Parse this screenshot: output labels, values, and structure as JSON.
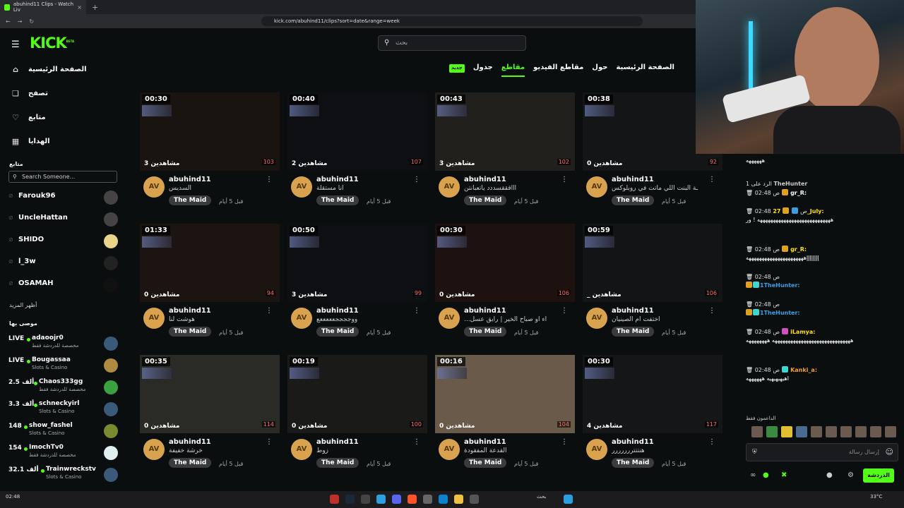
{
  "browser": {
    "tab_title": "abuhind11 Clips - Watch Liv",
    "new_tab": "+",
    "close_tab": "×",
    "url": "kick.com/abuhind11/clips?sort=date&range=week"
  },
  "header": {
    "logo": "KICK",
    "logo_sup": "BETA",
    "search_placeholder": "بحث"
  },
  "sidebar": {
    "nav": [
      {
        "label": "الصفحة الرئيسية"
      },
      {
        "label": "تصفح"
      },
      {
        "label": "متابع"
      },
      {
        "label": "الهدايا"
      }
    ],
    "following_title": "متابع",
    "search_placeholder": "Search Someone...",
    "following": [
      {
        "name": "Farouk96"
      },
      {
        "name": "UncleHattan"
      },
      {
        "name": "SHIDO"
      },
      {
        "name": "l_3w"
      },
      {
        "name": "OSAMAH"
      }
    ],
    "show_more": "أظهر المزيد",
    "recommended_title": "موصى بها",
    "recommended": [
      {
        "count": "LIVE",
        "name": "adaoojr0",
        "category": "مخصصة للدردشة فقط"
      },
      {
        "count": "LIVE",
        "name": "Bougassaa",
        "category": "Slots & Casino"
      },
      {
        "count": "2.5 ألف",
        "name": "Chaos333gg",
        "category": "مخصصة للدردشة فقط"
      },
      {
        "count": "3.3 ألف",
        "name": "schneckyirl",
        "category": "Slots & Casino"
      },
      {
        "count": "148",
        "name": "show_fashel",
        "category": "Slots & Casino"
      },
      {
        "count": "154",
        "name": "ImochTv0",
        "category": "مخصصة للدردشة فقط"
      },
      {
        "count": "32.1 ألف",
        "name": "Trainwreckstv",
        "category": "Slots & Casino"
      }
    ]
  },
  "content": {
    "tabs": [
      "الصفحة الرئيسية",
      "حول",
      "مقاطع الفيديو",
      "مقاطع",
      "جدول"
    ],
    "new_badge": "جديد",
    "clips": [
      {
        "duration": "00:30",
        "views": "3 مشاهدين",
        "likes": "103",
        "author": "abuhind11",
        "title": "السديس",
        "game": "The Maid",
        "age": "قبل 5 أيام"
      },
      {
        "duration": "00:40",
        "views": "2 مشاهدين",
        "likes": "107",
        "author": "abuhind11",
        "title": "انا مستقلة",
        "game": "The Maid",
        "age": "قبل 5 أيام"
      },
      {
        "duration": "00:43",
        "views": "3 مشاهدين",
        "likes": "102",
        "author": "abuhind11",
        "title": "اااقققسددد ياتعبانتن",
        "game": "The Maid",
        "age": "قبل 5 أيام"
      },
      {
        "duration": "00:38",
        "views": "0 مشاهدين",
        "likes": "92",
        "author": "abuhind11",
        "title": "ـة البنت اللي ماتت في روبلوكس",
        "game": "The Maid",
        "age": "قبل 5 أيام"
      },
      {
        "duration": "01:33",
        "views": "0 مشاهدين",
        "likes": "94",
        "author": "abuhind11",
        "title": "هوشت لنا",
        "game": "The Maid",
        "age": "قبل 5 أيام"
      },
      {
        "duration": "00:50",
        "views": "3 مشاهدين",
        "likes": "99",
        "author": "abuhind11",
        "title": "ووججججعععععع",
        "game": "The Maid",
        "age": "قبل 5 أيام"
      },
      {
        "duration": "00:30",
        "views": "0 مشاهدين",
        "likes": "106",
        "author": "abuhind11",
        "title": "...اء او صباح الخير | رايق عسل",
        "game": "The Maid",
        "age": "قبل 5 أيام"
      },
      {
        "duration": "00:59",
        "views": "_ مشاهدين",
        "likes": "106",
        "author": "abuhind11",
        "title": "اختفت ام الصينيان",
        "game": "The Maid",
        "age": "قبل 5 أيام"
      },
      {
        "duration": "00:35",
        "views": "0 مشاهدين",
        "likes": "114",
        "author": "abuhind11",
        "title": "خرشة خفيفة",
        "game": "The Maid",
        "age": "قبل 5 أيام"
      },
      {
        "duration": "00:19",
        "views": "0 مشاهدين",
        "likes": "100",
        "author": "abuhind11",
        "title": "زوط",
        "game": "The Maid",
        "age": "قبل 5 أيام"
      },
      {
        "duration": "00:16",
        "views": "0 مشاهدين",
        "likes": "104",
        "author": "abuhind11",
        "title": "القدعة المفقودة",
        "game": "The Maid",
        "age": "قبل 5 أيام"
      },
      {
        "duration": "00:30",
        "views": "4 مشاهدين",
        "likes": "117",
        "author": "abuhind11",
        "title": "هنتتتررررررر",
        "game": "The Maid",
        "age": "قبل 5 أيام"
      }
    ]
  },
  "chat": {
    "messages": [
      {
        "meta": "",
        "user": "",
        "text": "ههههههه"
      },
      {
        "meta": "الرد على 1",
        "user": "TheHunter",
        "text": ""
      },
      {
        "meta": "02:48 ص",
        "user": "gr_R:",
        "text": ""
      },
      {
        "meta": "02:48 ص",
        "user": "27_July:",
        "text": "ههههههههههههههههههههههههههههه ! ور"
      },
      {
        "meta": "02:48 ص",
        "user": "gr_R:",
        "text": "إإإإإإإإههههههههههههههههههههههه"
      },
      {
        "meta": "02:48 ص",
        "user": "1TheHunter:",
        "text": ""
      },
      {
        "meta": "02:48 ص",
        "user": "1TheHunter:",
        "text": ""
      },
      {
        "meta": "02:48 ص",
        "user": "iLamya:",
        "text": "ههههههههههههههههههههههههههههههه ههههههههه"
      },
      {
        "meta": "02:48 ص",
        "user": "Kanki_a:",
        "text": "اهيهيهيهيه ههههههه"
      }
    ],
    "supporters": "الداعمون فقط",
    "input_placeholder": "إرسال رسالة",
    "send_label": "الدردشة"
  },
  "taskbar": {
    "search": "بحث",
    "weather": "33°C",
    "time": "02:48"
  },
  "colors": {
    "accent": "#53fc18",
    "bg": "#0b0e0f"
  }
}
